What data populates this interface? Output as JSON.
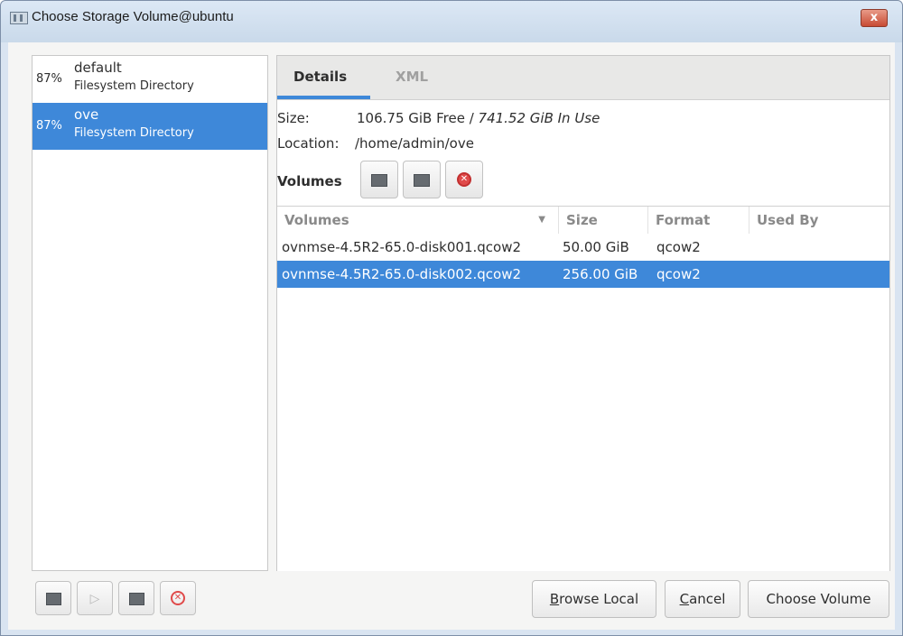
{
  "window": {
    "title": "Choose Storage Volume@ubuntu",
    "close_label": "x"
  },
  "pools": [
    {
      "pct": "87%",
      "name": "default",
      "type": "Filesystem Directory",
      "selected": false
    },
    {
      "pct": "87%",
      "name": "ove",
      "type": "Filesystem Directory",
      "selected": true
    }
  ],
  "tabs": {
    "details": "Details",
    "xml": "XML"
  },
  "details": {
    "size_label": "Size:",
    "size_free": "106.75 GiB Free / ",
    "size_in_use": "741.52 GiB In Use",
    "location_label": "Location:",
    "location_value": "/home/admin/ove",
    "volumes_label": "Volumes"
  },
  "table": {
    "columns": [
      "Volumes",
      "Size",
      "Format",
      "Used By"
    ],
    "rows": [
      {
        "name": "ovnmse-4.5R2-65.0-disk001.qcow2",
        "size": "50.00 GiB",
        "format": "qcow2",
        "used_by": "",
        "selected": false
      },
      {
        "name": "ovnmse-4.5R2-65.0-disk002.qcow2",
        "size": "256.00 GiB",
        "format": "qcow2",
        "used_by": "",
        "selected": true
      }
    ]
  },
  "buttons": {
    "browse_local_pre": "",
    "browse_local_mn": "B",
    "browse_local_post": "rowse Local",
    "cancel_mn": "C",
    "cancel_post": "ancel",
    "choose_volume": "Choose Volume"
  },
  "icons": {
    "add_volume": "new-volume-icon",
    "refresh": "refresh-icon",
    "delete": "delete-icon",
    "add_pool": "add-pool-icon",
    "start_pool": "play-icon",
    "stop_pool": "stop-icon",
    "delete_pool": "delete-icon"
  },
  "colors": {
    "selection": "#3e88d9",
    "delete": "#e04a4a"
  }
}
